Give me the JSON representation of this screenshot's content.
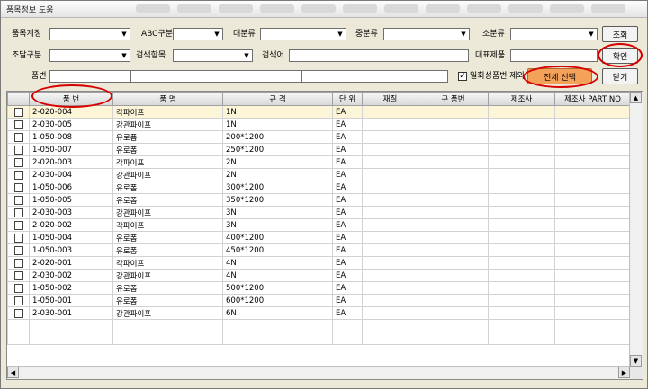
{
  "window": {
    "title": "품목정보 도움"
  },
  "filters": {
    "item_account_label": "품목계정",
    "abc_label": "ABC구분",
    "major_label": "대분류",
    "mid_label": "중분류",
    "minor_label": "소분류",
    "procure_label": "조달구분",
    "search_field_label": "검색항목",
    "keyword_label": "검색어",
    "rep_item_label": "대표제품",
    "item_no_label": "품번",
    "exclude_label": "일회성품번 제외"
  },
  "buttons": {
    "search": "조회",
    "confirm": "확인",
    "select_all": "전체 선택",
    "close": "닫기"
  },
  "table": {
    "columns": [
      "품 번",
      "품 명",
      "규 격",
      "단 위",
      "재질",
      "구 품번",
      "제조사",
      "제조사 PART NO"
    ],
    "rows": [
      [
        "2-020-004",
        "각파이프",
        "1N",
        "EA"
      ],
      [
        "2-030-005",
        "강관파이프",
        "1N",
        "EA"
      ],
      [
        "1-050-008",
        "유로폼",
        "200*1200",
        "EA"
      ],
      [
        "1-050-007",
        "유로폼",
        "250*1200",
        "EA"
      ],
      [
        "2-020-003",
        "각파이프",
        "2N",
        "EA"
      ],
      [
        "2-030-004",
        "강관파이프",
        "2N",
        "EA"
      ],
      [
        "1-050-006",
        "유로폼",
        "300*1200",
        "EA"
      ],
      [
        "1-050-005",
        "유로폼",
        "350*1200",
        "EA"
      ],
      [
        "2-030-003",
        "강관파이프",
        "3N",
        "EA"
      ],
      [
        "2-020-002",
        "각파이프",
        "3N",
        "EA"
      ],
      [
        "1-050-004",
        "유로폼",
        "400*1200",
        "EA"
      ],
      [
        "1-050-003",
        "유로폼",
        "450*1200",
        "EA"
      ],
      [
        "2-020-001",
        "각파이프",
        "4N",
        "EA"
      ],
      [
        "2-030-002",
        "강관파이프",
        "4N",
        "EA"
      ],
      [
        "1-050-002",
        "유로폼",
        "500*1200",
        "EA"
      ],
      [
        "1-050-001",
        "유로폼",
        "600*1200",
        "EA"
      ],
      [
        "2-030-001",
        "강관파이프",
        "6N",
        "EA"
      ]
    ]
  },
  "colors": {
    "annotation": "#d60000",
    "select_all_bg": "#f4a15a",
    "first_row_bg": "#fdf5d8"
  }
}
